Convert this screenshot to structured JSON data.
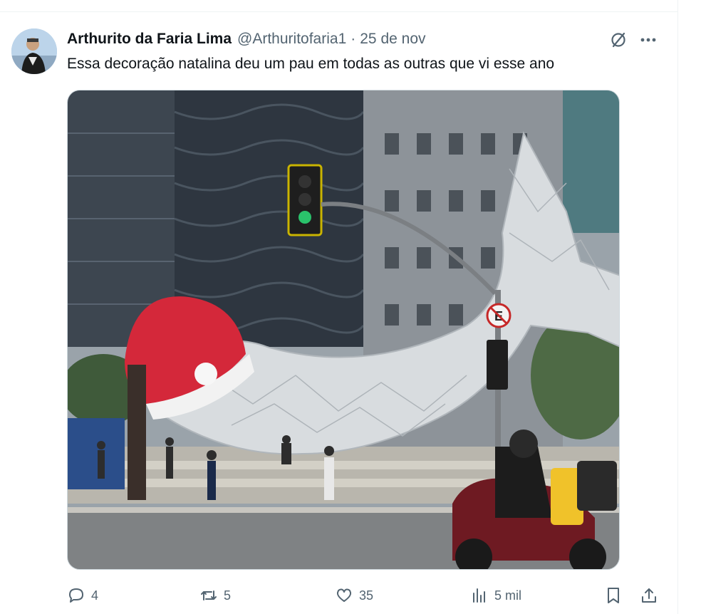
{
  "tweet": {
    "author_name": "Arthurito da Faria Lima",
    "handle": "@Arthuritofaria1",
    "separator": "·",
    "time": "25 de nov",
    "text": "Essa decoração natalina deu um pau em todas as outras que vi esse ano"
  },
  "media": {
    "type": "photo",
    "sign_letter": "E"
  },
  "actions": {
    "replies": "4",
    "reposts": "5",
    "likes": "35",
    "views": "5 mil"
  },
  "icons": {
    "grok": "grok-slash-icon",
    "more": "more-dots-icon",
    "reply": "reply-bubble-icon",
    "repost": "repost-arrows-icon",
    "like": "heart-icon",
    "views": "bar-chart-icon",
    "bookmark": "bookmark-icon",
    "share": "share-upload-icon"
  },
  "colors": {
    "text_primary": "#0f1419",
    "text_secondary": "#536471",
    "border": "#cfd9de"
  }
}
